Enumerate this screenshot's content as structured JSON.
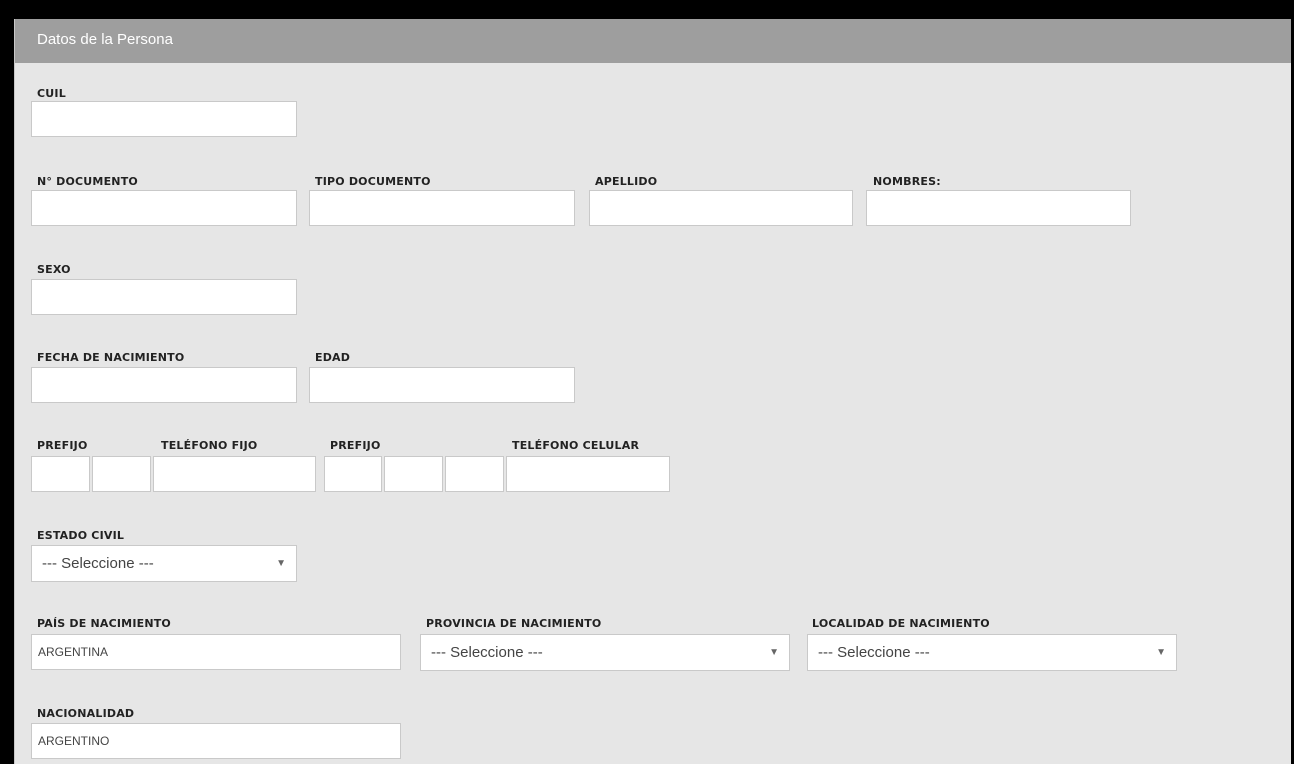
{
  "section": {
    "title": "Datos de la Persona"
  },
  "fields": {
    "cuil": {
      "label": "CUIL",
      "value": ""
    },
    "documento": {
      "label": "N° DOCUMENTO",
      "value": ""
    },
    "tipo_documento": {
      "label": "TIPO DOCUMENTO",
      "value": ""
    },
    "apellido": {
      "label": "APELLIDO",
      "value": ""
    },
    "nombres": {
      "label": "NOMBRES:",
      "value": ""
    },
    "sexo": {
      "label": "SEXO",
      "value": ""
    },
    "fecha_nacimiento": {
      "label": "FECHA DE NACIMIENTO",
      "value": ""
    },
    "edad": {
      "label": "EDAD",
      "value": ""
    },
    "prefijo_fijo": {
      "label": "PREFIJO"
    },
    "telefono_fijo": {
      "label": "TELÉFONO FIJO"
    },
    "prefijo_celular": {
      "label": "PREFIJO"
    },
    "telefono_celular": {
      "label": "TELÉFONO CELULAR"
    },
    "estado_civil": {
      "label": "ESTADO CIVIL",
      "value": "--- Seleccione ---"
    },
    "pais_nacimiento": {
      "label": "PAÍS DE NACIMIENTO",
      "value": "ARGENTINA"
    },
    "provincia_nacimiento": {
      "label": "PROVINCIA DE NACIMIENTO",
      "value": "--- Seleccione ---"
    },
    "localidad_nacimiento": {
      "label": "LOCALIDAD DE NACIMIENTO",
      "value": "--- Seleccione ---"
    },
    "nacionalidad": {
      "label": "NACIONALIDAD",
      "value": "ARGENTINO"
    }
  },
  "icons": {
    "dropdown": "chevron-down-icon"
  },
  "colors": {
    "header_bg": "#9e9e9e",
    "panel_bg": "#e6e6e6",
    "input_border": "#c9c9c9"
  }
}
